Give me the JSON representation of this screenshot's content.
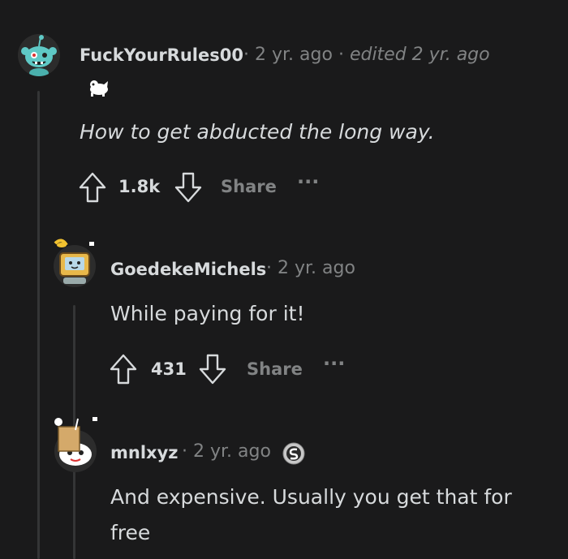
{
  "comments": [
    {
      "username": "FuckYourRules00",
      "age": "2 yr. ago",
      "edited": "edited 2 yr. ago",
      "body": "How to get abducted the long way.",
      "votes": "1.8k",
      "share": "Share"
    },
    {
      "username": "GoedekeMichels",
      "age": "2 yr. ago",
      "body": "While paying for it!",
      "votes": "431",
      "share": "Share"
    },
    {
      "username": "mnlxyz",
      "age": "2 yr. ago",
      "body_lines": [
        "And expensive. Usually you get that for",
        "free"
      ]
    }
  ],
  "separator": "·",
  "more_glyph": "···",
  "colors": {
    "background": "#1a1a1b",
    "text": "#d7dadc",
    "muted": "#818384",
    "thread": "#343536"
  }
}
